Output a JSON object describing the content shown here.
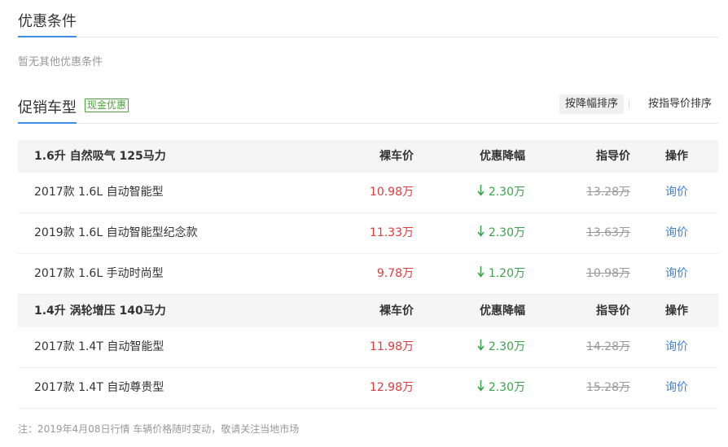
{
  "offers": {
    "title": "优惠条件",
    "empty_text": "暂无其他优惠条件"
  },
  "promo": {
    "title": "促销车型",
    "badge": "现金优惠",
    "sort_by_discount": "按降幅排序",
    "sort_by_guide": "按指导价排序"
  },
  "groups": [
    {
      "name": "1.6升 自然吸气 125马力",
      "col_price": "裸车价",
      "col_discount": "优惠降幅",
      "col_guide": "指导价",
      "col_action": "操作",
      "rows": [
        {
          "model": "2017款 1.6L 自动智能型",
          "price": "10.98万",
          "discount": "2.30万",
          "guide": "13.28万",
          "action": "询价"
        },
        {
          "model": "2019款 1.6L 自动智能型纪念款",
          "price": "11.33万",
          "discount": "2.30万",
          "guide": "13.63万",
          "action": "询价"
        },
        {
          "model": "2017款 1.6L 手动时尚型",
          "price": "9.78万",
          "discount": "1.20万",
          "guide": "10.98万",
          "action": "询价"
        }
      ]
    },
    {
      "name": "1.4升 涡轮增压 140马力",
      "col_price": "裸车价",
      "col_discount": "优惠降幅",
      "col_guide": "指导价",
      "col_action": "操作",
      "rows": [
        {
          "model": "2017款 1.4T 自动智能型",
          "price": "11.98万",
          "discount": "2.30万",
          "guide": "14.28万",
          "action": "询价"
        },
        {
          "model": "2017款 1.4T 自动尊贵型",
          "price": "12.98万",
          "discount": "2.30万",
          "guide": "15.28万",
          "action": "询价"
        }
      ]
    }
  ],
  "footer_note": "注：2019年4月08日行情 车辆价格随时变动，敬请关注当地市场",
  "colors": {
    "accent": "#3e8ee8",
    "price": "#e2393b",
    "discount": "#3ca34b",
    "link": "#3b80d6",
    "muted": "#999999"
  }
}
